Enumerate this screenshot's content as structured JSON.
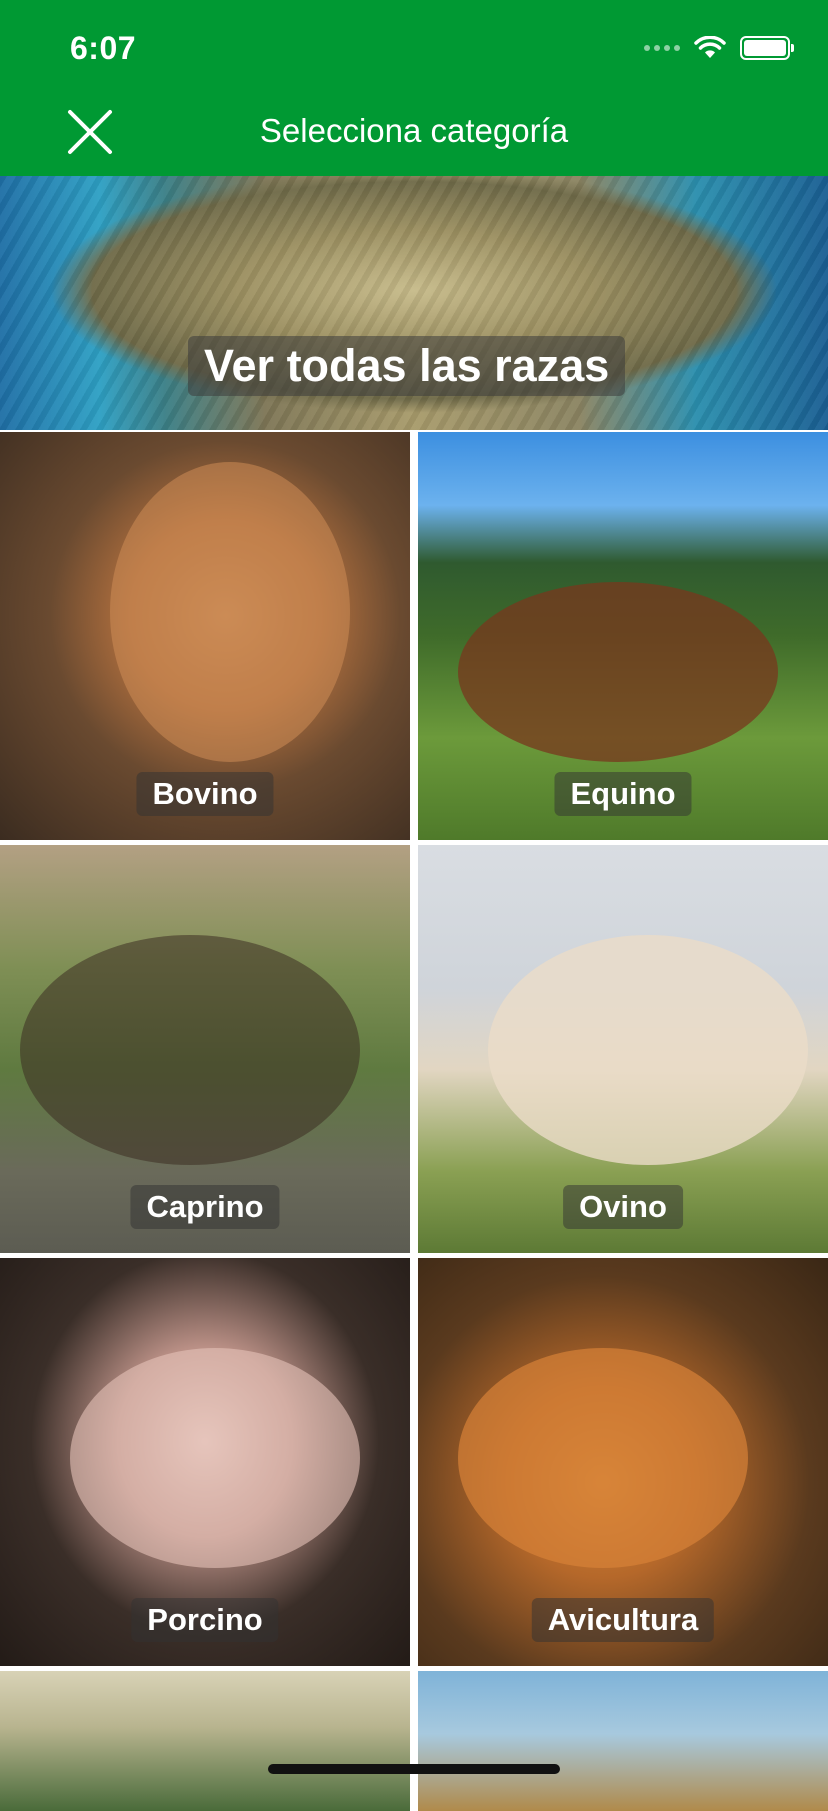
{
  "status_bar": {
    "time": "6:07"
  },
  "header": {
    "title": "Selecciona categoría"
  },
  "banner": {
    "label": "Ver todas las razas"
  },
  "categories": [
    {
      "label": "Bovino"
    },
    {
      "label": "Equino"
    },
    {
      "label": "Caprino"
    },
    {
      "label": "Ovino"
    },
    {
      "label": "Porcino"
    },
    {
      "label": "Avicultura"
    }
  ],
  "colors": {
    "header_bg": "#009933",
    "label_overlay": "rgba(50,50,50,0.5)"
  },
  "icons": {
    "close": "close-icon",
    "signal": "signal-icon",
    "wifi": "wifi-icon",
    "battery": "battery-icon"
  }
}
